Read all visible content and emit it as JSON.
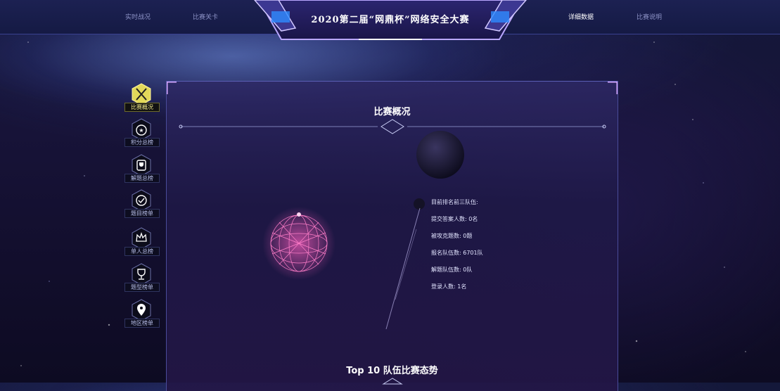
{
  "header": {
    "title": "2020第二届“网鼎杯”网络安全大赛",
    "nav_left": [
      "实时战况",
      "比赛关卡"
    ],
    "nav_right": [
      "详细数据",
      "比赛说明"
    ]
  },
  "sidebar": {
    "items": [
      {
        "label": "比赛概况",
        "icon": "swords-icon",
        "active": true
      },
      {
        "label": "积分总榜",
        "icon": "star-badge-icon",
        "active": false
      },
      {
        "label": "解题总榜",
        "icon": "trophy-icon",
        "active": false
      },
      {
        "label": "题目榜单",
        "icon": "check-circle-icon",
        "active": false
      },
      {
        "label": "单人总榜",
        "icon": "crown-icon",
        "active": false
      },
      {
        "label": "题型榜单",
        "icon": "trophy-icon",
        "active": false
      },
      {
        "label": "地区榜单",
        "icon": "map-pin-icon",
        "active": false
      }
    ]
  },
  "overview": {
    "title": "比赛概况",
    "stats": [
      "目前排名前三队伍:",
      "提交答案人数: 0名",
      "被攻克题数: 0题",
      "报名队伍数: 6701队",
      "解题队伍数: 0队",
      "登录人数: 1名"
    ]
  },
  "top10": {
    "title": "Top 10 队伍比赛态势"
  },
  "colors": {
    "accent": "#a06cff",
    "globe": "#ff4fb4",
    "panel": "#2a2462"
  }
}
